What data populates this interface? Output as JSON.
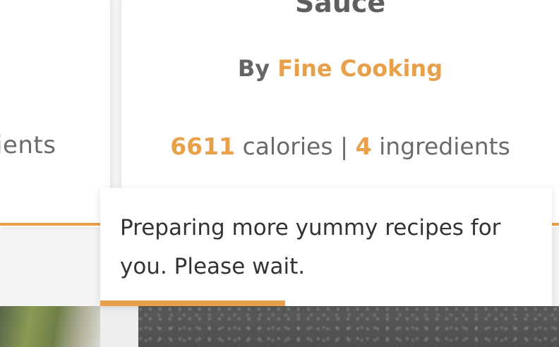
{
  "colors": {
    "accent": "#e8a04a",
    "text_dark": "#333333",
    "text_muted": "#6a6a6a",
    "title": "#5f5f5f"
  },
  "left_card": {
    "meta_tail": "ients"
  },
  "main_card": {
    "title": "Sauce",
    "by_label": "By",
    "author": "Fine Cooking",
    "calories_value": "6611",
    "calories_label": "calories",
    "separator": "|",
    "ingredients_value": "4",
    "ingredients_label": "ingredients"
  },
  "toast": {
    "message": "Preparing more yummy recipes for you. Please wait.",
    "progress_fraction": 0.41
  }
}
